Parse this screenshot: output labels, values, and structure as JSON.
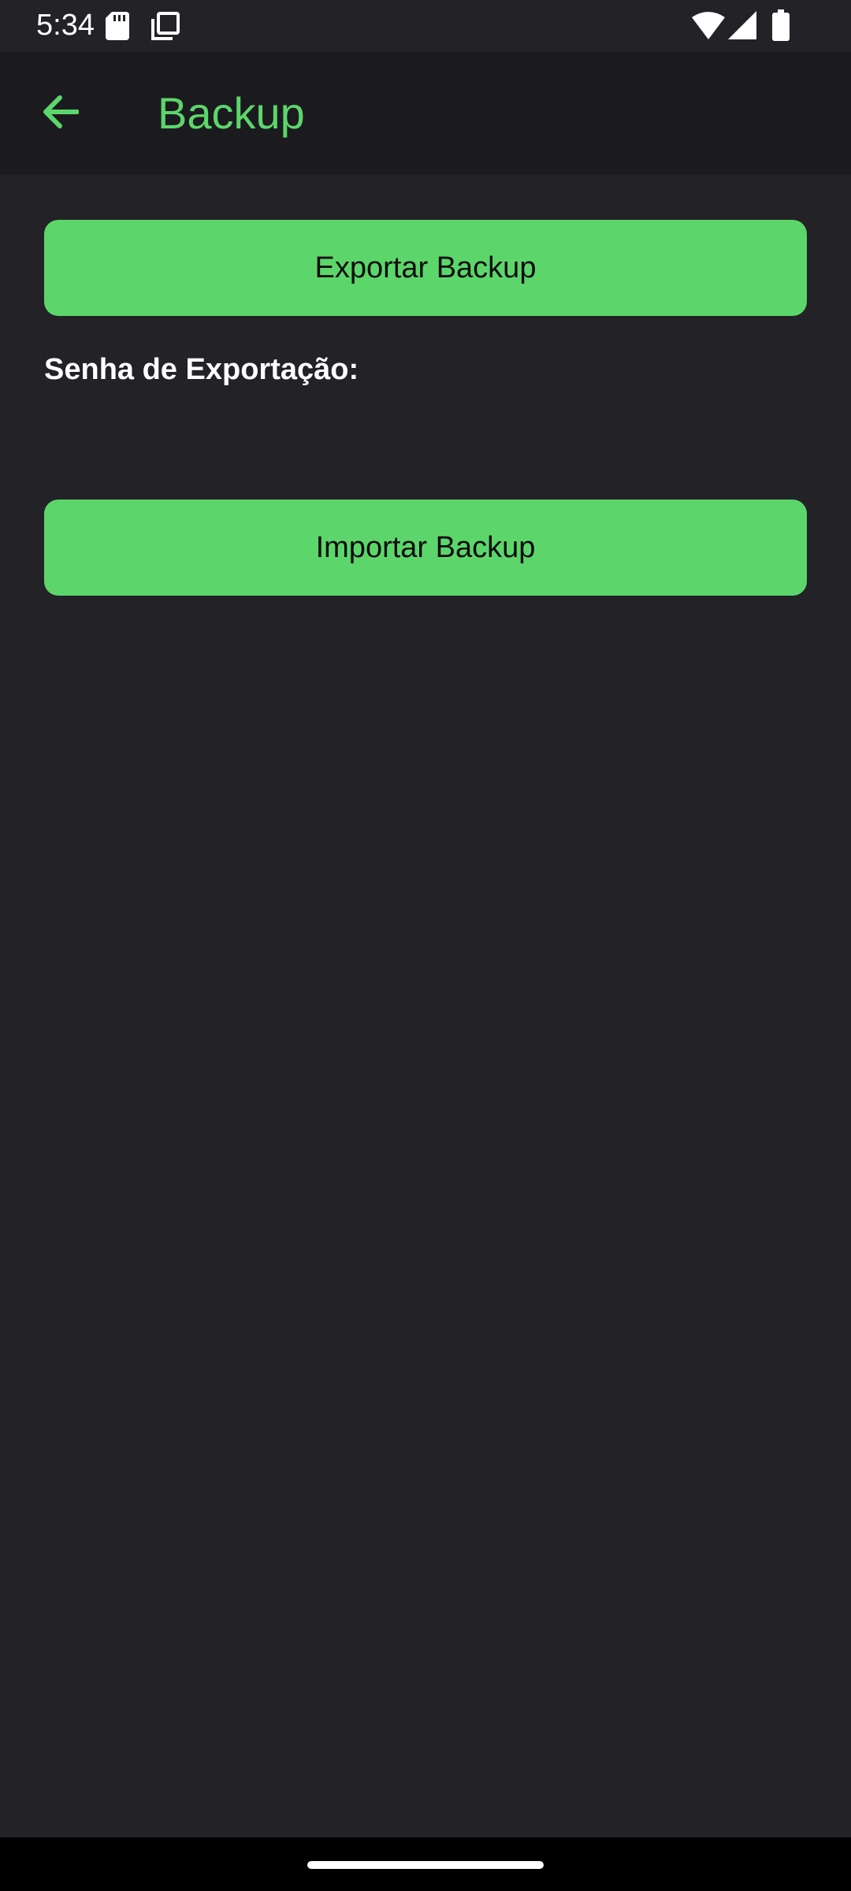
{
  "status_bar": {
    "time": "5:34",
    "icons": [
      "sd-card-icon",
      "copy-icon",
      "wifi-icon",
      "signal-icon",
      "battery-icon"
    ]
  },
  "app_bar": {
    "back_icon": "arrow-back-icon",
    "title": "Backup",
    "accent_color": "#5cd66b"
  },
  "main": {
    "export_button_label": "Exportar Backup",
    "password_label": "Senha de Exportação:",
    "password_value": "",
    "import_button_label": "Importar Backup"
  },
  "colors": {
    "background": "#232227",
    "app_bar": "#1b1a1f",
    "button": "#5cd66b",
    "button_text": "#0d0d0d"
  }
}
